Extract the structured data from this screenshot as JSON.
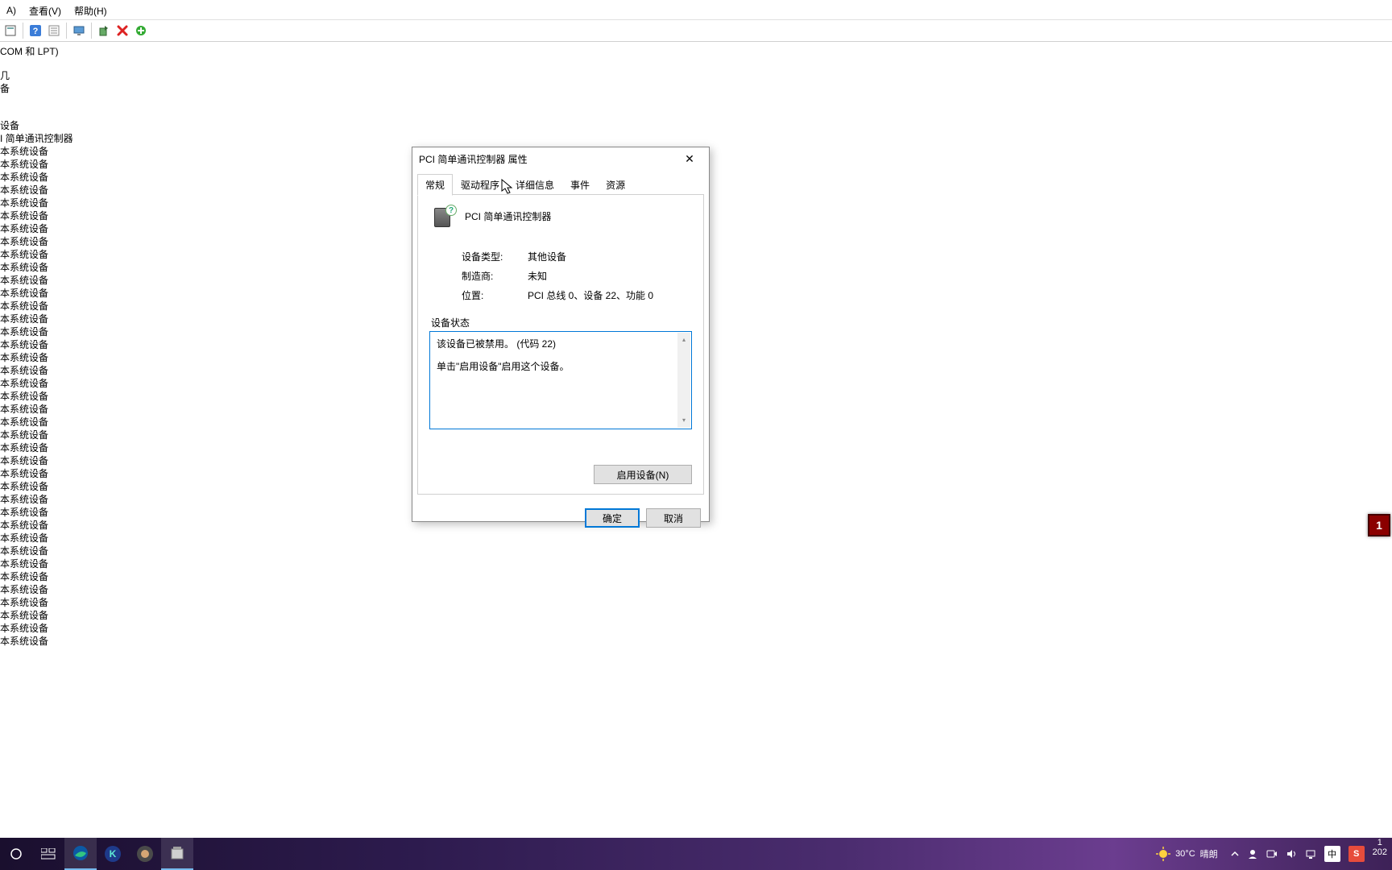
{
  "menubar": {
    "action": "A)",
    "view": "查看(V)",
    "help": "帮助(H)"
  },
  "tree": {
    "ports": "COM 和 LPT)",
    "node1": "几",
    "node2": "备",
    "category": "设备",
    "pci_item": "I 简单通讯控制器",
    "sys_item": "本系统设备"
  },
  "dialog": {
    "title": "PCI 简单通讯控制器 属性",
    "tabs": {
      "general": "常规",
      "driver": "驱动程序",
      "details": "详细信息",
      "events": "事件",
      "resources": "资源"
    },
    "device_name": "PCI 简单通讯控制器",
    "info": {
      "type_label": "设备类型:",
      "type_value": "其他设备",
      "mfr_label": "制造商:",
      "mfr_value": "未知",
      "loc_label": "位置:",
      "loc_value": "PCI 总线 0、设备 22、功能 0"
    },
    "status_label": "设备状态",
    "status_line1": "该设备已被禁用。 (代码 22)",
    "status_line2": "单击\"启用设备\"启用这个设备。",
    "enable_btn": "启用设备(N)",
    "ok": "确定",
    "cancel": "取消"
  },
  "taskbar": {
    "weather_temp": "30°C",
    "weather_cond": "晴朗",
    "ime": "中",
    "sogou": "S",
    "time1": "1",
    "time2": "202"
  },
  "float_badge": "1"
}
